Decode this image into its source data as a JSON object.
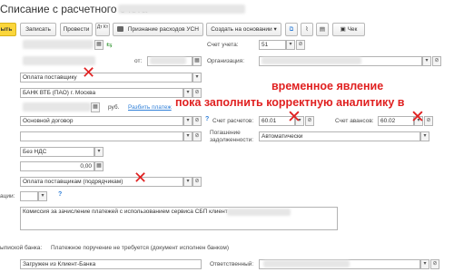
{
  "window": {
    "title": "Списание с расчетного счета"
  },
  "toolbar": {
    "post_close": "ыть",
    "save": "Записать",
    "post": "Провести",
    "dt_kt": "Дт Кт",
    "usn": "Признание расходов УСН",
    "create_based": "Создать на основании",
    "check": "Чек"
  },
  "form": {
    "from_label": "от:",
    "account_label": "Счет учета:",
    "account_value": "51",
    "org_label": "Организация:",
    "operation_value": "Оплата поставщику",
    "bank_value": "БАНК ВТБ (ПАО) г. Москва",
    "currency_unit": "руб.",
    "split_link": "Разбить платеж",
    "contract_value": "Основной договор",
    "calc_label": "Счет расчетов:",
    "calc_value": "60.01",
    "adv_label": "Счет авансов:",
    "adv_value": "60.02",
    "debt_label_1": "Погашение",
    "debt_label_2": "задолженности:",
    "debt_value": "Автоматически",
    "vat_value": "Без НДС",
    "vat_amount": "0,00",
    "cashflow_value": "Оплата поставщикам (подрядчикам)",
    "analytics_label": "ации:",
    "comment_value": "Комиссия за зачисление платежей с использованием сервиса СБП клиент",
    "bank_statement_label": "ыпиской банка:",
    "bank_statement_value": "Платежное поручение не требуется (документ исполнен банком)",
    "source_value": "Загружен из Клиент-Банка",
    "responsible_label": "Ответственный:"
  },
  "annotation": {
    "line1": "временное явление",
    "line2": "пока заполнить корректную аналитику в",
    "color": "#e02020"
  }
}
